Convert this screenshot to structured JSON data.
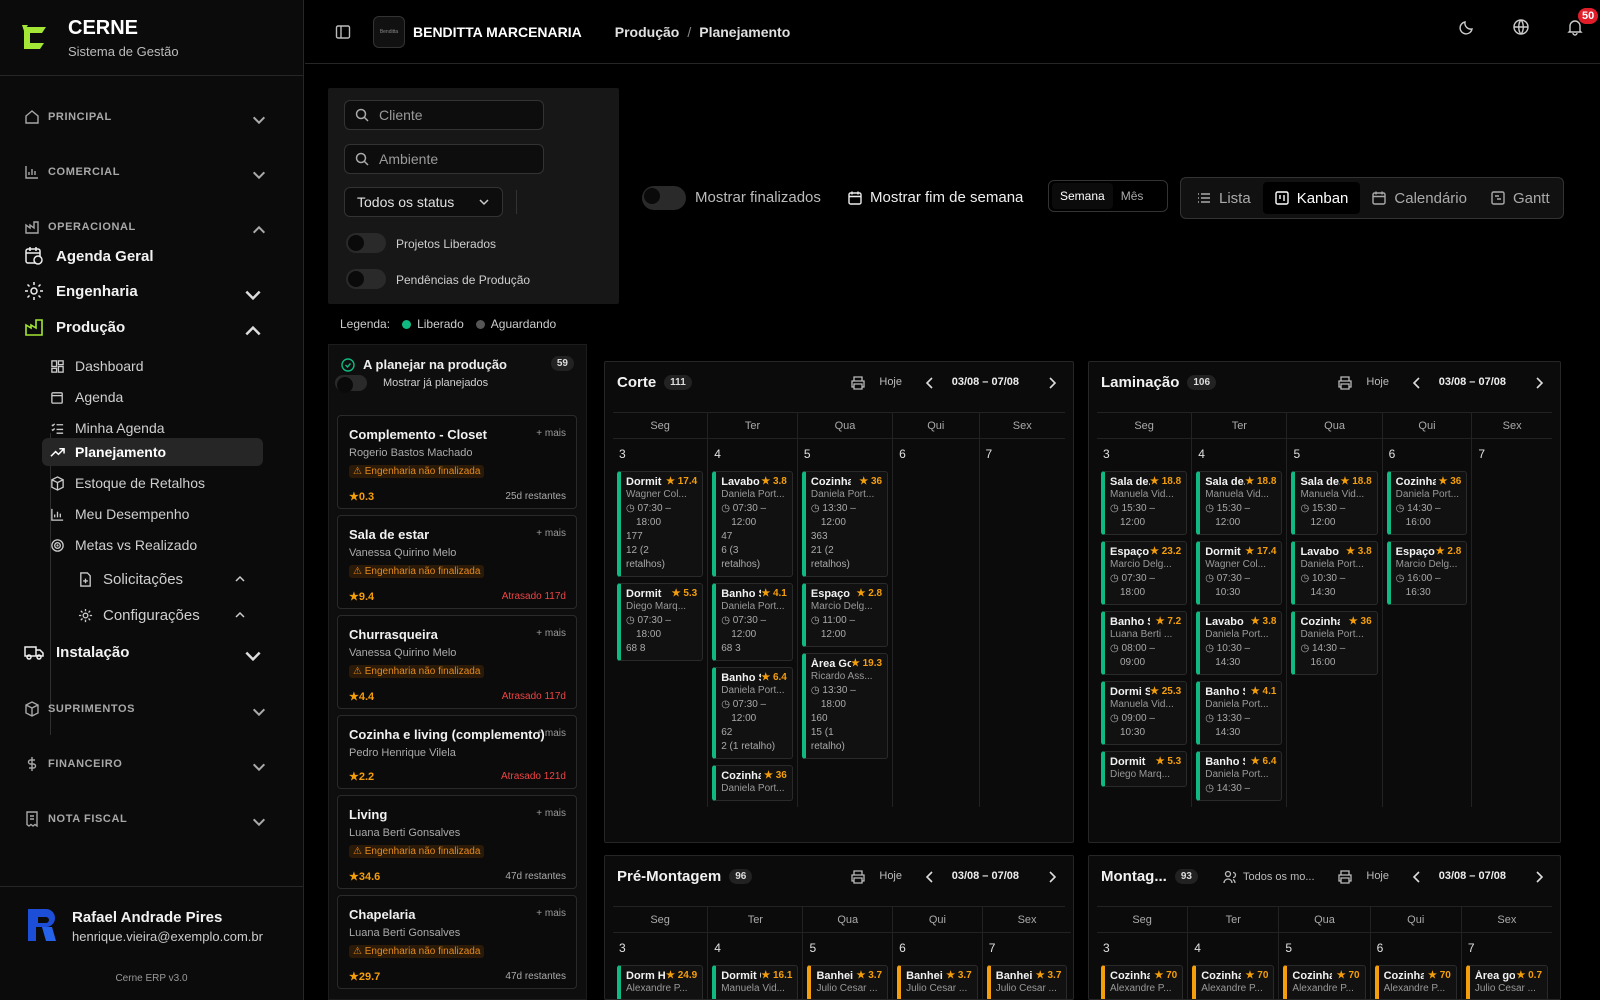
{
  "brand": {
    "name": "CERNE",
    "subtitle": "Sistema de Gestão"
  },
  "nav": {
    "principal": "PRINCIPAL",
    "comercial": "COMERCIAL",
    "operacional": "OPERACIONAL",
    "agenda_geral": "Agenda Geral",
    "engenharia": "Engenharia",
    "producao": "Produção",
    "sub": [
      "Dashboard",
      "Agenda",
      "Minha Agenda",
      "Planejamento",
      "Estoque de Retalhos",
      "Meu Desempenho",
      "Metas vs Realizado",
      "Solicitações",
      "Configurações"
    ],
    "instalacao": "Instalação",
    "suprimentos": "SUPRIMENTOS",
    "financeiro": "FINANCEIRO",
    "nota_fiscal": "NOTA FISCAL"
  },
  "user": {
    "name": "Rafael Andrade Pires",
    "email": "henrique.vieira@exemplo.com.br",
    "version": "Cerne ERP v3.0"
  },
  "topbar": {
    "company_logo_text": "Benditta",
    "company": "BENDITTA MARCENARIA",
    "crumb1": "Produção",
    "crumb_sep": "/",
    "crumb2": "Planejamento",
    "notifications": "50"
  },
  "filters": {
    "cliente_placeholder": "Cliente",
    "ambiente_placeholder": "Ambiente",
    "status": "Todos os status",
    "projetos_liberados": "Projetos Liberados",
    "pendencias": "Pendências de Produção"
  },
  "legend": {
    "label": "Legenda:",
    "liberado": "Liberado",
    "aguardando": "Aguardando",
    "liberado_color": "#10b981",
    "aguardando_color": "#555555"
  },
  "controls": {
    "mostrar_finalizados": "Mostrar finalizados",
    "mostrar_fim_semana": "Mostrar fim de semana",
    "semana": "Semana",
    "mes": "Mês",
    "lista": "Lista",
    "kanban": "Kanban",
    "calendario": "Calendário",
    "gantt": "Gantt"
  },
  "queue": {
    "title": "A planejar na produção",
    "count": "59",
    "toggle": "Mostrar já planejados",
    "more": "+ mais",
    "warning": "Engenharia não finalizada",
    "items": [
      {
        "title": "Complemento - Closet",
        "client": "Rogerio Bastos Machado",
        "warn": true,
        "score": "0.3",
        "deadline": "25d restantes",
        "late": false
      },
      {
        "title": "Sala de estar",
        "client": "Vanessa Quirino Melo",
        "warn": true,
        "score": "9.4",
        "deadline": "Atrasado 117d",
        "late": true
      },
      {
        "title": "Churrasqueira",
        "client": "Vanessa Quirino Melo",
        "warn": true,
        "score": "4.4",
        "deadline": "Atrasado 117d",
        "late": true
      },
      {
        "title": "Cozinha e living (complemento)",
        "client": "Pedro Henrique Vilela",
        "warn": false,
        "score": "2.2",
        "deadline": "Atrasado 121d",
        "late": true
      },
      {
        "title": "Living",
        "client": "Luana Berti Gonsalves",
        "warn": true,
        "score": "34.6",
        "deadline": "47d restantes",
        "late": false
      },
      {
        "title": "Chapelaria",
        "client": "Luana Berti Gonsalves",
        "warn": true,
        "score": "29.7",
        "deadline": "47d restantes",
        "late": false
      }
    ]
  },
  "boards": [
    {
      "title": "Corte",
      "count": "111",
      "today": "Hoje",
      "range": "03/08 – 07/08",
      "days": [
        "Seg",
        "Ter",
        "Qua",
        "Qui",
        "Sex"
      ],
      "nums": [
        "3",
        "4",
        "5",
        "6",
        "7"
      ],
      "cards": [
        [
          {
            "n": "Dormit",
            "s": "17.4",
            "c": "Wagner Col...",
            "t1": "07:30 –",
            "t2": "18:00",
            "m": [
              "177",
              "12 (2",
              "retalhos)"
            ]
          },
          {
            "n": "Dormit",
            "s": "5.3",
            "c": "Diego Marq...",
            "t1": "07:30 –",
            "t2": "18:00",
            "m": [
              "68  8"
            ]
          }
        ],
        [
          {
            "n": "Lavabo",
            "s": "3.8",
            "c": "Daniela Port...",
            "t1": "07:30 –",
            "t2": "12:00",
            "m": [
              "47",
              "6 (3",
              "retalhos)"
            ]
          },
          {
            "n": "Banho Suíte...",
            "s": "4.1",
            "c": "Daniela Port...",
            "t1": "07:30 –",
            "t2": "12:00",
            "m": [
              "68  3"
            ]
          },
          {
            "n": "Banho Suít...",
            "s": "6.4",
            "c": "Daniela Port...",
            "t1": "07:30 –",
            "t2": "12:00",
            "m": [
              "62",
              "2 (1 retalho)"
            ]
          },
          {
            "n": "Cozinha",
            "s": "36",
            "c": "Daniela Port...",
            "t1": "",
            "t2": "",
            "m": []
          }
        ],
        [
          {
            "n": "Cozinha",
            "s": "36",
            "c": "Daniela Port...",
            "t1": "13:30 –",
            "t2": "12:00",
            "m": [
              "363",
              "21 (2",
              "retalhos)"
            ]
          },
          {
            "n": "Espaço Teens",
            "s": "2.8",
            "c": "Marcio Delg...",
            "t1": "11:00 –",
            "t2": "12:00",
            "m": []
          },
          {
            "n": "Área Gourm",
            "s": "19.3",
            "c": "Ricardo Ass...",
            "t1": "13:30 –",
            "t2": "18:00",
            "m": [
              "160",
              "15 (1",
              "retalho)"
            ]
          }
        ],
        [],
        []
      ]
    },
    {
      "title": "Laminação",
      "count": "106",
      "today": "Hoje",
      "range": "03/08 – 07/08",
      "days": [
        "Seg",
        "Ter",
        "Qua",
        "Qui",
        "Sex"
      ],
      "nums": [
        "3",
        "4",
        "5",
        "6",
        "7"
      ],
      "cards": [
        [
          {
            "n": "Sala de...",
            "s": "18.8",
            "c": "Manuela Vid...",
            "t1": "15:30 –",
            "t2": "12:00",
            "m": []
          },
          {
            "n": "Espaço Teens",
            "s": "23.2",
            "c": "Marcio Delg...",
            "t1": "07:30 –",
            "t2": "18:00",
            "m": []
          },
          {
            "n": "Banho Suíte...",
            "s": "7.2",
            "c": "Luana Berti ...",
            "t1": "08:00 –",
            "t2": "09:00",
            "m": []
          },
          {
            "n": "Dormi Suí...",
            "s": "25.3",
            "c": "Manuela Vid...",
            "t1": "09:00 –",
            "t2": "10:30",
            "m": []
          },
          {
            "n": "Dormit",
            "s": "5.3",
            "c": "Diego Marq...",
            "t1": "",
            "t2": "",
            "m": []
          }
        ],
        [
          {
            "n": "Sala de...",
            "s": "18.8",
            "c": "Manuela Vid...",
            "t1": "15:30 –",
            "t2": "12:00",
            "m": []
          },
          {
            "n": "Dormit",
            "s": "17.4",
            "c": "Wagner Col...",
            "t1": "07:30 –",
            "t2": "10:30",
            "m": []
          },
          {
            "n": "Lavabo",
            "s": "3.8",
            "c": "Daniela Port...",
            "t1": "10:30 –",
            "t2": "14:30",
            "m": []
          },
          {
            "n": "Banho Suíte...",
            "s": "4.1",
            "c": "Daniela Port...",
            "t1": "13:30 –",
            "t2": "14:30",
            "m": []
          },
          {
            "n": "Banho Suít...",
            "s": "6.4",
            "c": "Daniela Port...",
            "t1": "14:30 –",
            "t2": "",
            "m": []
          }
        ],
        [
          {
            "n": "Sala de...",
            "s": "18.8",
            "c": "Manuela Vid...",
            "t1": "15:30 –",
            "t2": "12:00",
            "m": []
          },
          {
            "n": "Lavabo",
            "s": "3.8",
            "c": "Daniela Port...",
            "t1": "10:30 –",
            "t2": "14:30",
            "m": []
          },
          {
            "n": "Cozinha",
            "s": "36",
            "c": "Daniela Port...",
            "t1": "14:30 –",
            "t2": "16:00",
            "m": []
          }
        ],
        [
          {
            "n": "Cozinha",
            "s": "36",
            "c": "Daniela Port...",
            "t1": "14:30 –",
            "t2": "16:00",
            "m": []
          },
          {
            "n": "Espaço Teens",
            "s": "2.8",
            "c": "Marcio Delg...",
            "t1": "16:00 –",
            "t2": "16:30",
            "m": []
          }
        ],
        []
      ]
    },
    {
      "title": "Pré-Montagem",
      "count": "96",
      "today": "Hoje",
      "range": "03/08 – 07/08",
      "days": [
        "Seg",
        "Ter",
        "Qua",
        "Qui",
        "Sex"
      ],
      "nums": [
        "3",
        "4",
        "5",
        "6",
        "7"
      ],
      "cards": [
        [
          {
            "n": "Dorm Hósp",
            "s": "24.9",
            "c": "Alexandre P...",
            "t1": "",
            "t2": "",
            "m": [],
            "y": false
          }
        ],
        [
          {
            "n": "Dormit 01",
            "s": "16.1",
            "c": "Manuela Vid...",
            "t1": "",
            "t2": "",
            "m": [],
            "y": false
          }
        ],
        [
          {
            "n": "Banhei",
            "s": "3.7",
            "c": "Julio Cesar ...",
            "t1": "",
            "t2": "",
            "m": [],
            "y": true
          }
        ],
        [
          {
            "n": "Banhei",
            "s": "3.7",
            "c": "Julio Cesar ...",
            "t1": "",
            "t2": "",
            "m": [],
            "y": true
          }
        ],
        [
          {
            "n": "Banhei",
            "s": "3.7",
            "c": "Julio Cesar ...",
            "t1": "",
            "t2": "",
            "m": [],
            "y": true
          }
        ]
      ]
    },
    {
      "title": "Montag...",
      "count": "93",
      "filter": "Todos os mo...",
      "today": "Hoje",
      "range": "03/08 – 07/08",
      "days": [
        "Seg",
        "Ter",
        "Qua",
        "Qui",
        "Sex"
      ],
      "nums": [
        "3",
        "4",
        "5",
        "6",
        "7"
      ],
      "cards": [
        [
          {
            "n": "Cozinha",
            "s": "70",
            "c": "Alexandre P...",
            "t1": "",
            "t2": "",
            "m": [],
            "y": true
          }
        ],
        [
          {
            "n": "Cozinha",
            "s": "70",
            "c": "Alexandre P...",
            "t1": "",
            "t2": "",
            "m": [],
            "y": true
          }
        ],
        [
          {
            "n": "Cozinha",
            "s": "70",
            "c": "Alexandre P...",
            "t1": "",
            "t2": "",
            "m": [],
            "y": true
          }
        ],
        [
          {
            "n": "Cozinha",
            "s": "70",
            "c": "Alexandre P...",
            "t1": "",
            "t2": "",
            "m": [],
            "y": true
          }
        ],
        [
          {
            "n": "Área gourm",
            "s": "0.7",
            "c": "Julio Cesar ...",
            "t1": "",
            "t2": "",
            "m": [],
            "y": true
          }
        ]
      ]
    }
  ]
}
